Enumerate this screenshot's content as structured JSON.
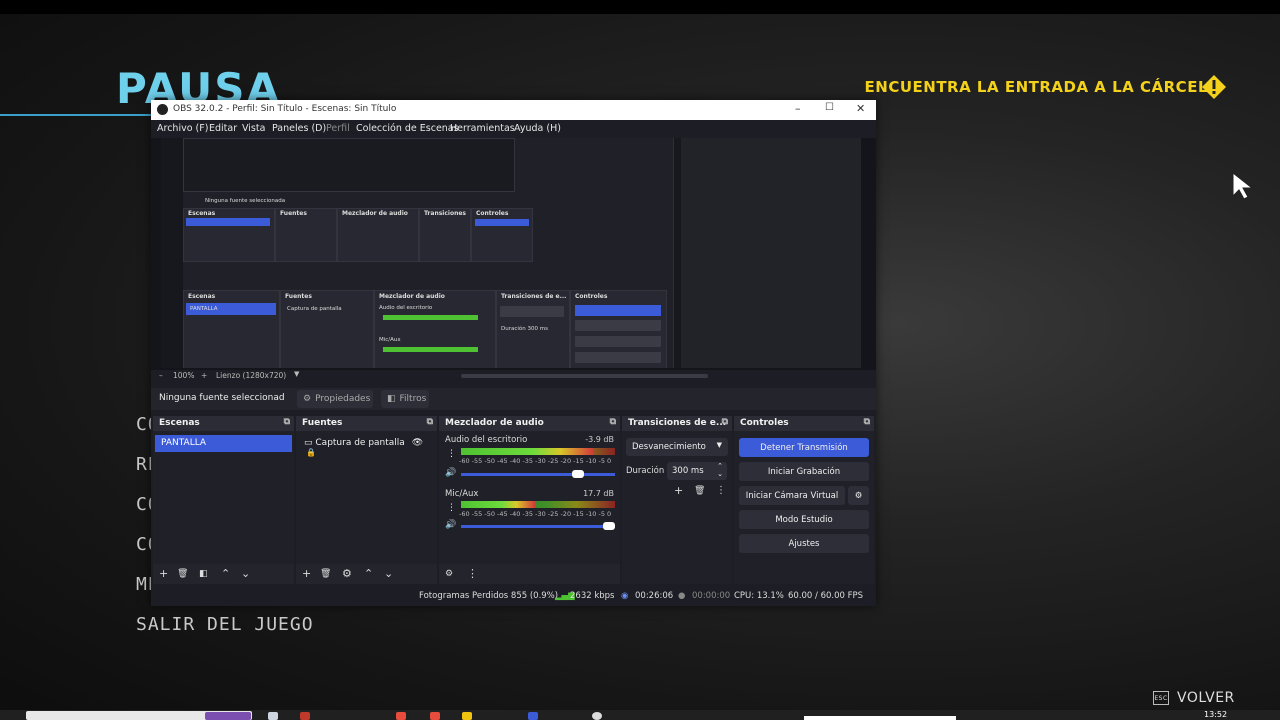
{
  "game": {
    "title": "PAUSA",
    "objective": "ENCUENTRA LA ENTRADA A LA CÁRCEL",
    "menu_visible": [
      "CO",
      "RE",
      "CO",
      "CO",
      "ME"
    ],
    "quit_label": "SALIR DEL JUEGO",
    "back_label": "VOLVER",
    "back_key": "ESC",
    "accent_color": "#6fd0ec",
    "objective_color": "#f4d21b"
  },
  "obs": {
    "window_title": "OBS 32.0.2 - Perfil: Sin Título - Escenas: Sin Título",
    "menu": [
      "Archivo (F)",
      "Editar",
      "Vista",
      "Paneles (D)",
      "Perfil",
      "Colección de Escenas",
      "Herramientas",
      "Ayuda (H)"
    ],
    "preview_status": {
      "zoom": "100%",
      "canvas": "Lienzo (1280x720)"
    },
    "source_bar": {
      "label": "Ninguna fuente seleccionad",
      "properties": "Propiedades",
      "filters": "Filtros"
    },
    "scenes": {
      "title": "Escenas",
      "items": [
        "PANTALLA"
      ]
    },
    "sources": {
      "title": "Fuentes",
      "items": [
        "Captura de pantalla"
      ]
    },
    "mixer": {
      "title": "Mezclador de audio",
      "ticks": "-60 -55 -50 -45 -40 -35 -30 -25 -20 -15 -10 -5 0",
      "channels": [
        {
          "name": "Audio del escritorio",
          "db": "-3.9 dB",
          "level": 0.86,
          "volume": 0.8
        },
        {
          "name": "Mic/Aux",
          "db": "17.7 dB",
          "level": 0.48,
          "volume": 1.0
        }
      ]
    },
    "transitions": {
      "title": "Transiciones de e...",
      "type": "Desvanecimiento",
      "duration_label": "Duración",
      "duration": "300 ms"
    },
    "controls": {
      "title": "Controles",
      "stop_stream": "Detener Transmisión",
      "start_record": "Iniciar Grabación",
      "virtual_cam": "Iniciar Cámara Virtual",
      "studio_mode": "Modo Estudio",
      "settings": "Ajustes",
      "accent": "#3c5bd9"
    },
    "status": {
      "dropped": "Fotogramas Perdidos 855 (0.9%)",
      "bitrate": "2632 kbps",
      "stream_time": "00:26:06",
      "rec_time": "00:00:00",
      "cpu": "CPU: 13.1%",
      "fps": "60.00 / 60.00 FPS"
    }
  },
  "taskbar": {
    "time": "13:52"
  }
}
